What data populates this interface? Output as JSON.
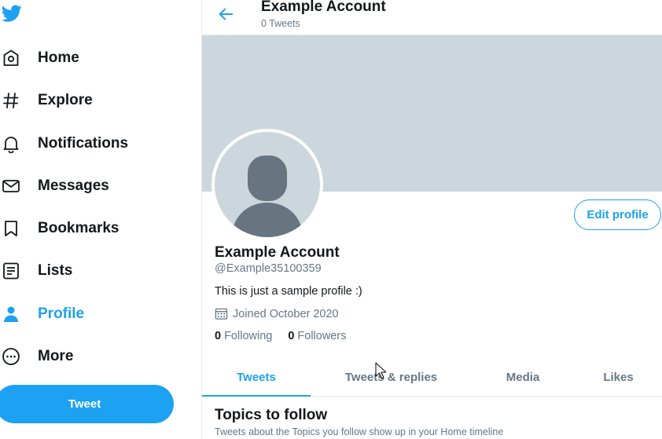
{
  "sidebar": {
    "items": [
      {
        "label": "Home",
        "icon": "home-icon"
      },
      {
        "label": "Explore",
        "icon": "hashtag-icon"
      },
      {
        "label": "Notifications",
        "icon": "bell-icon"
      },
      {
        "label": "Messages",
        "icon": "envelope-icon"
      },
      {
        "label": "Bookmarks",
        "icon": "bookmark-icon"
      },
      {
        "label": "Lists",
        "icon": "list-icon"
      },
      {
        "label": "Profile",
        "icon": "person-icon",
        "active": true
      },
      {
        "label": "More",
        "icon": "more-circle-icon"
      }
    ],
    "tweet_label": "Tweet"
  },
  "header": {
    "title": "Example Account",
    "subtitle": "0 Tweets"
  },
  "profile": {
    "edit_label": "Edit profile",
    "name": "Example Account",
    "handle": "@Example35100359",
    "bio": "This is just a sample profile :)",
    "joined": "Joined October 2020",
    "following_count": "0",
    "following_label": "Following",
    "followers_count": "0",
    "followers_label": "Followers"
  },
  "tabs": [
    {
      "label": "Tweets",
      "active": true
    },
    {
      "label": "Tweets & replies"
    },
    {
      "label": "Media"
    },
    {
      "label": "Likes"
    }
  ],
  "topics": {
    "title": "Topics to follow",
    "subtitle": "Tweets about the Topics you follow show up in your Home timeline"
  },
  "colors": {
    "accent": "#1da1f2",
    "banner": "#ccd6dd",
    "avatar_figure": "#66757f",
    "text_primary": "#14171a",
    "text_secondary": "#657786"
  }
}
